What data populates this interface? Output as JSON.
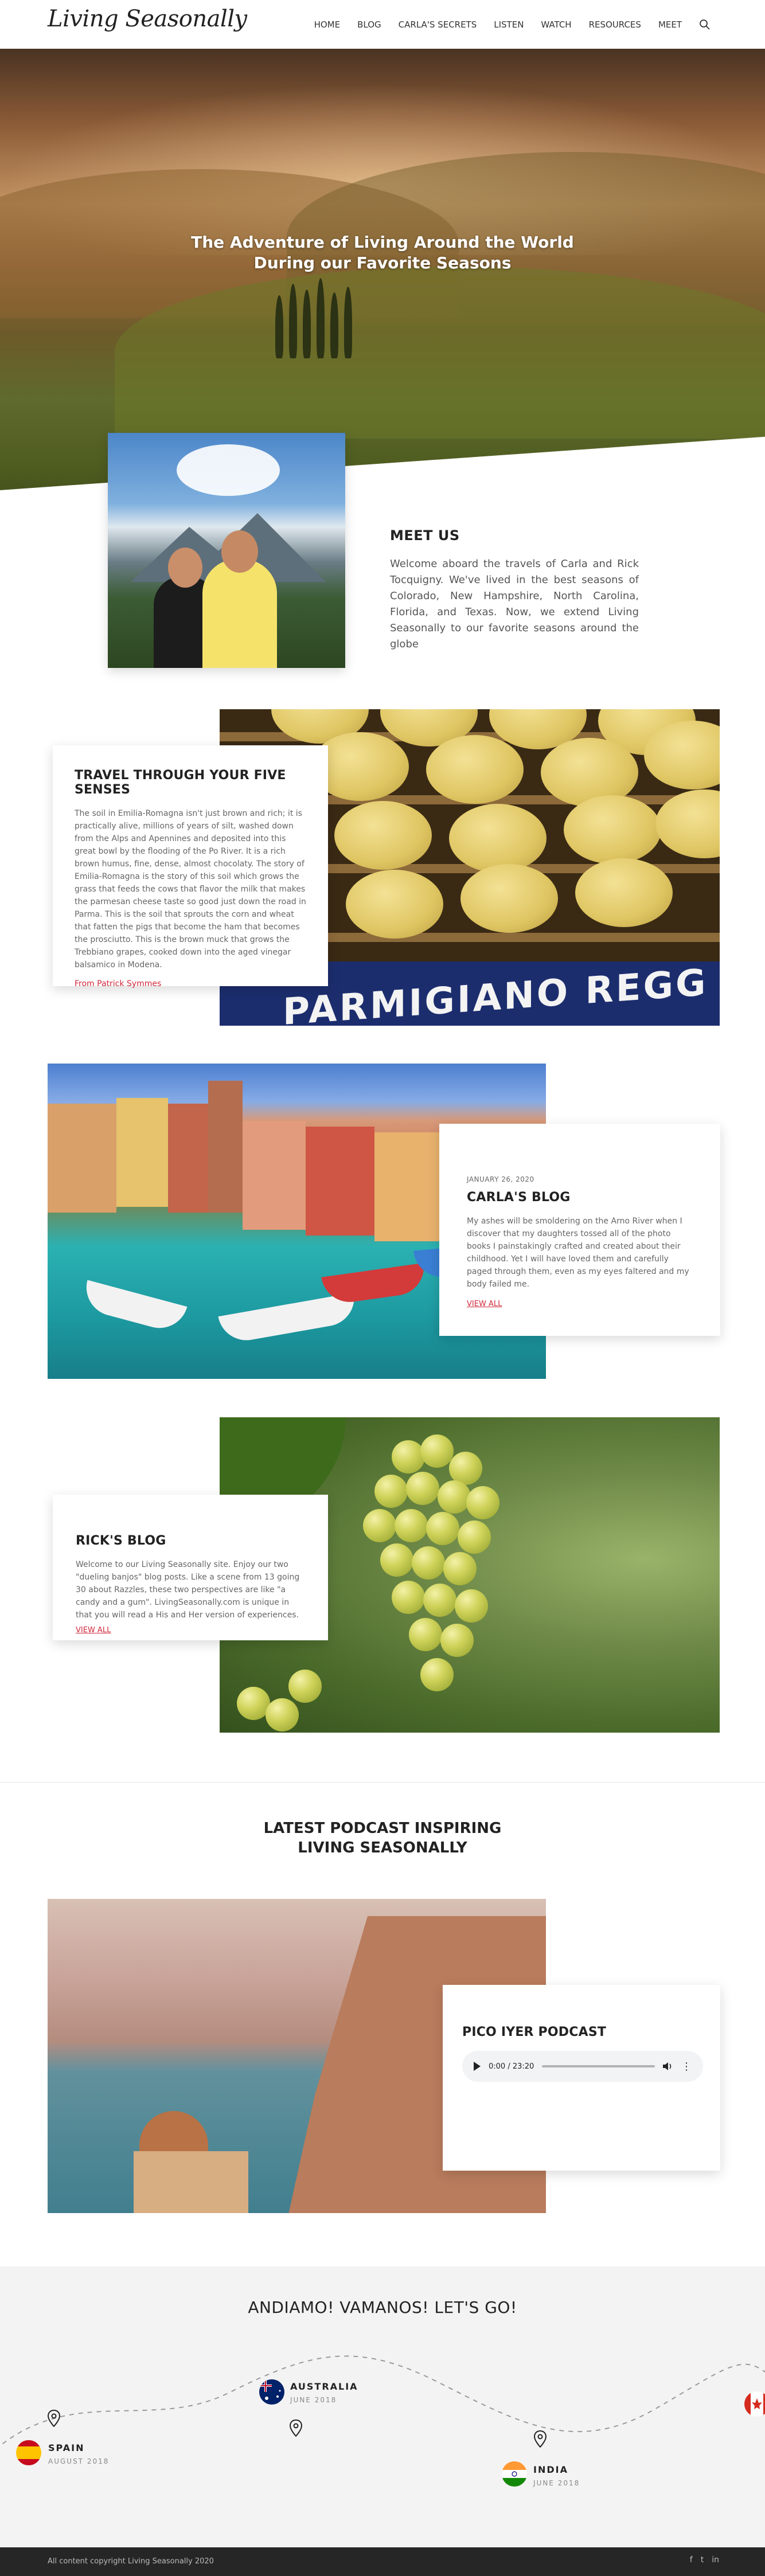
{
  "header": {
    "logo": "Living Seasonally",
    "nav": [
      "HOME",
      "BLOG",
      "CARLA'S SECRETS",
      "LISTEN",
      "WATCH",
      "RESOURCES",
      "MEET"
    ],
    "search_icon": "search-icon"
  },
  "hero": {
    "title_line1": "The Adventure of Living Around the World",
    "title_line2": "During our Favorite Seasons"
  },
  "meet": {
    "title": "MEET US",
    "text": "Welcome aboard the travels of Carla and Rick Tocquigny. We've lived in the best seasons of Colorado, New Hampshire, North Carolina, Florida, and Texas. Now, we extend Living Seasonally to our favorite seasons around the globe"
  },
  "senses": {
    "title": "TRAVEL THROUGH YOUR FIVE SENSES",
    "text": "The soil in Emilia-Romagna isn't just brown and rich; it is practically alive, millions of years of silt, washed down from the Alps and Apennines and deposited into this great bowl by the flooding of the Po River. It is a rich brown humus, fine, dense, almost chocolaty. The story of Emilia-Romagna is the story of this soil which grows the grass that feeds the cows that flavor the milk that makes the parmesan cheese taste so good just down the road in Parma. This is the soil that sprouts the corn and wheat that fatten the pigs that become the ham that becomes the prosciutto. This is the brown muck that grows the Trebbiano grapes, cooked down into the aged vinegar balsamico in Modena.",
    "from": "From Patrick Symmes",
    "sign_text": "PARMIGIANO REGG"
  },
  "carla_blog": {
    "date": "JANUARY 26, 2020",
    "title": "CARLA'S BLOG",
    "text": "My ashes will be smoldering on the Arno River when I discover that my daughters tossed all of the photo books I painstakingly crafted and created about their childhood. Yet I will have loved them and carefully paged through them, even as my eyes faltered and my body failed me.",
    "link": "VIEW ALL"
  },
  "rick_blog": {
    "title": "RICK'S BLOG",
    "text": "Welcome to our Living Seasonally site. Enjoy our two \"dueling banjos\" blog posts. Like a scene from 13 going 30 about Razzles, these two perspectives are like \"a candy and a gum\". LivingSeasonally.com is unique in that you will read a His and Her version of experiences.",
    "link": "VIEW ALL"
  },
  "podcast": {
    "section_title_line1": "LATEST PODCAST INSPIRING",
    "section_title_line2": "LIVING SEASONALLY",
    "card_title": "PICO IYER PODCAST",
    "player_time": "0:00 / 23:20"
  },
  "travel": {
    "title": "ANDIAMO! VAMANOS! LET'S GO!",
    "stops": [
      {
        "name": "SPAIN",
        "when": "AUGUST 2018"
      },
      {
        "name": "AUSTRALIA",
        "when": "JUNE 2018"
      },
      {
        "name": "INDIA",
        "when": "JUNE 2018"
      }
    ]
  },
  "footer": {
    "copyright": "All content copyright Living Seasonally 2020",
    "social": [
      "f",
      "t",
      "in"
    ]
  }
}
